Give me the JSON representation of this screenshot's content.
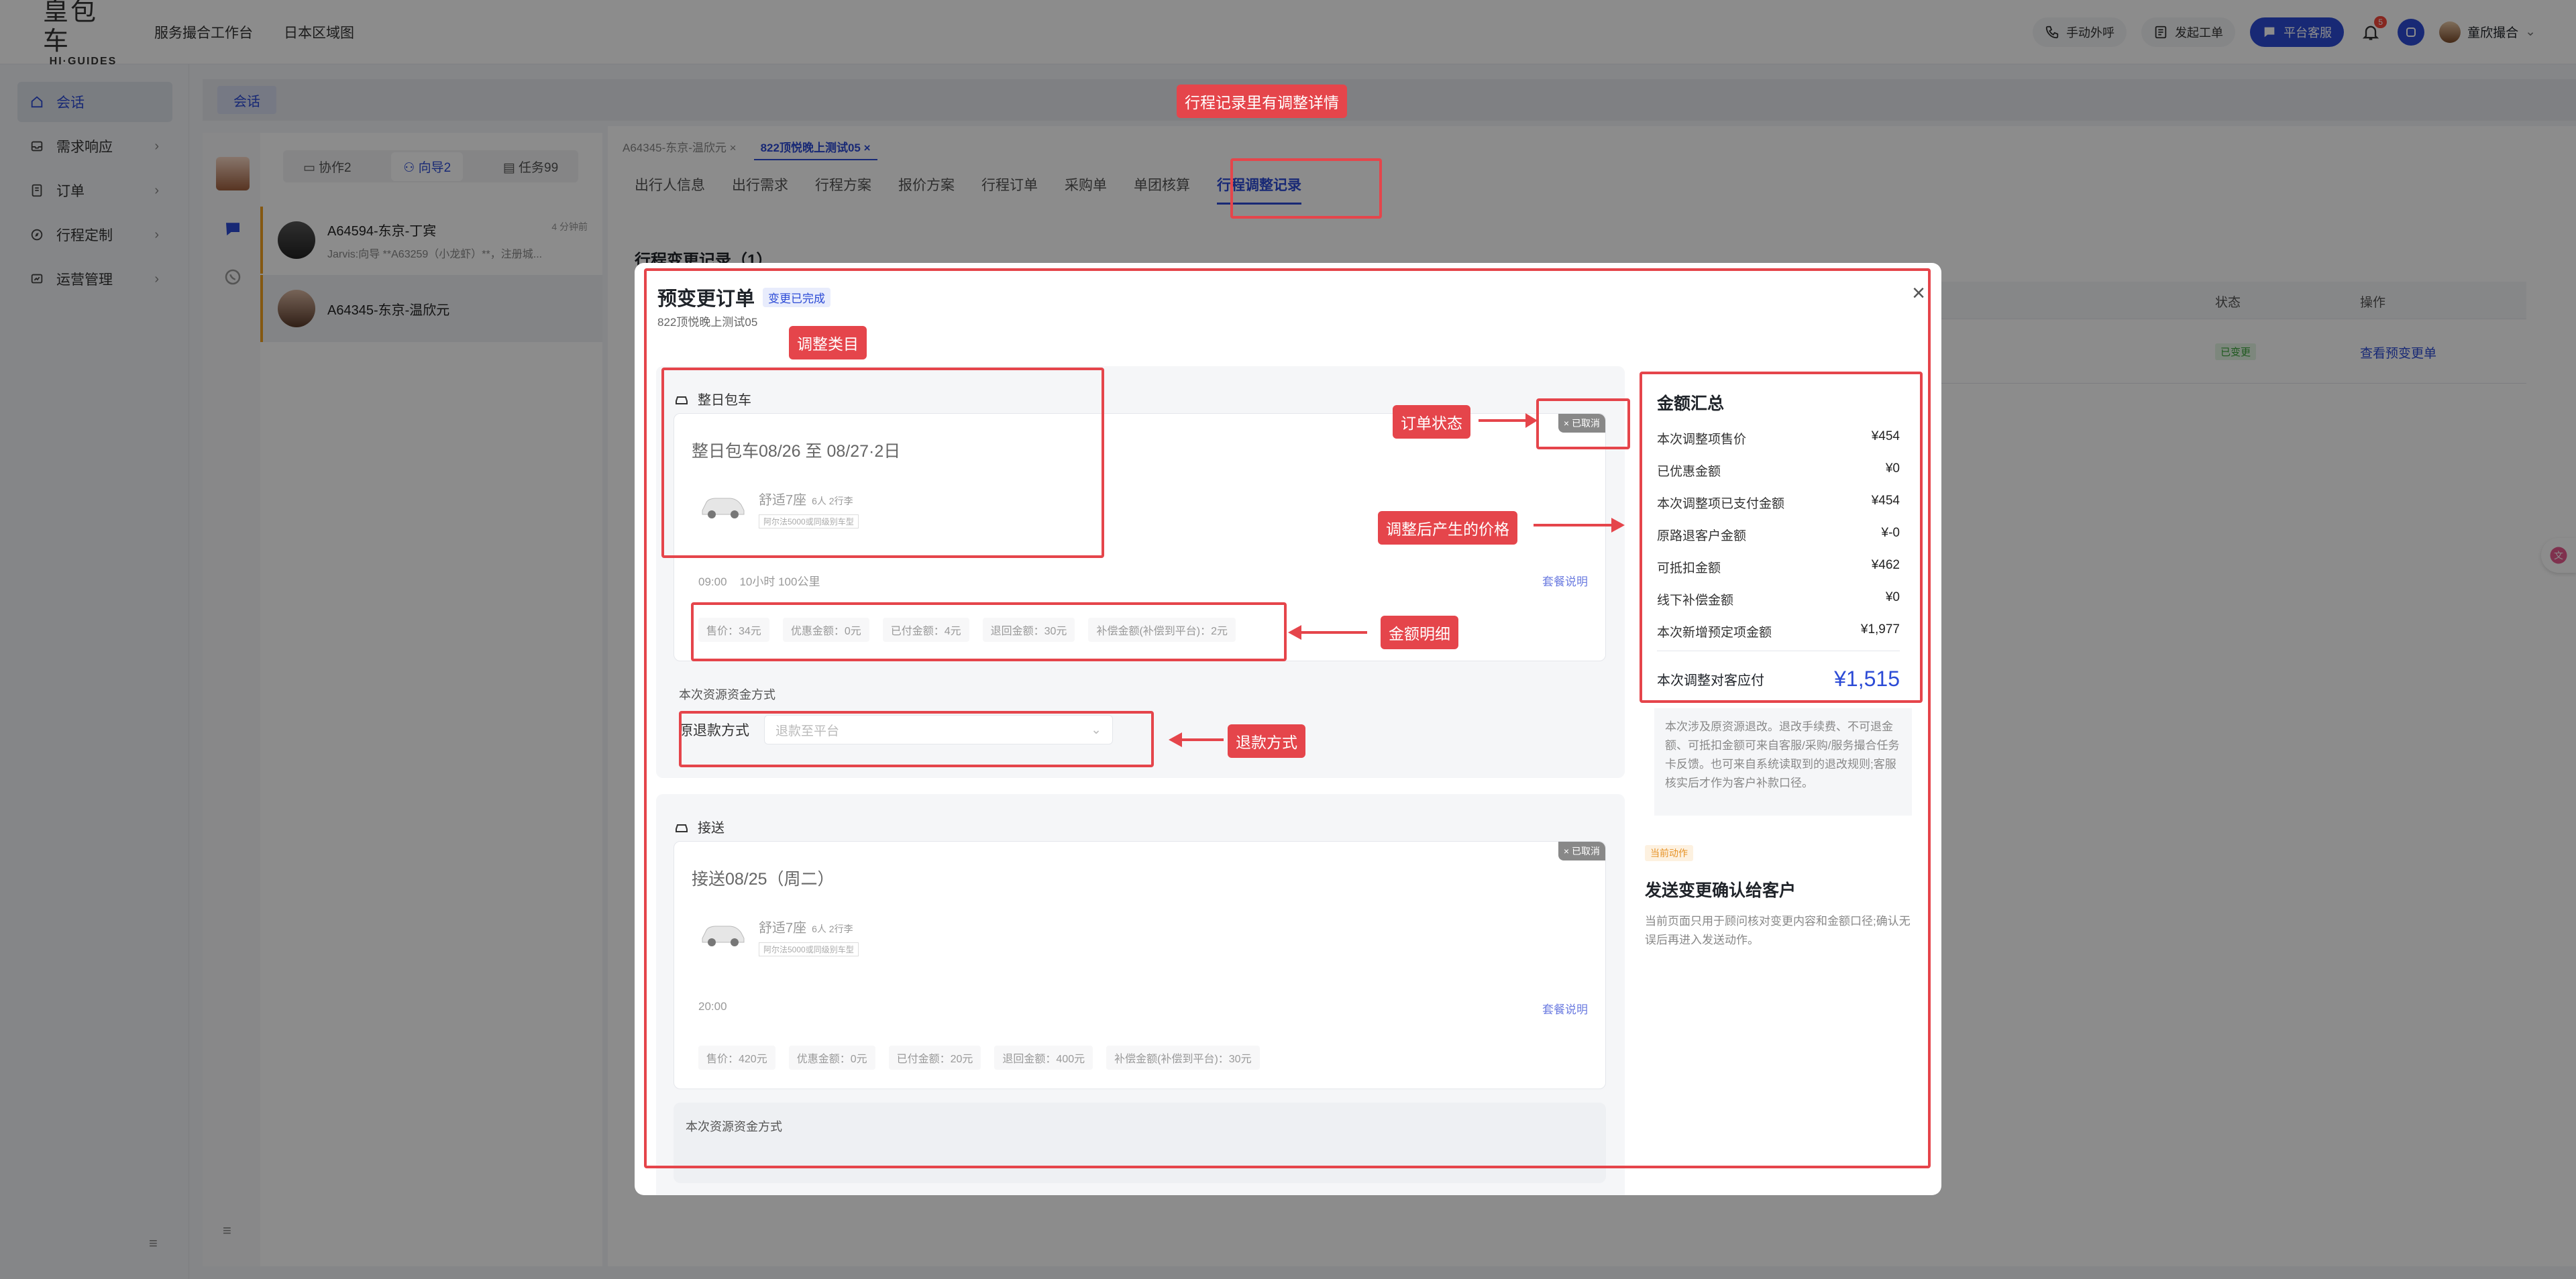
{
  "brand": {
    "cn": "皇包车",
    "en": "HI·GUIDES"
  },
  "topnav": [
    "服务撮合工作台",
    "日本区域图"
  ],
  "topright": {
    "call": "手动外呼",
    "ticket": "发起工单",
    "service": "平台客服",
    "bell_count": "5",
    "user": "童欣撮合"
  },
  "sidebar": {
    "items": [
      {
        "label": "会话"
      },
      {
        "label": "需求响应"
      },
      {
        "label": "订单"
      },
      {
        "label": "行程定制"
      },
      {
        "label": "运营管理"
      }
    ],
    "footer": "≡"
  },
  "session_tab": "会话",
  "chat": {
    "tabs": [
      "协作2",
      "向导2",
      "任务99"
    ],
    "conversations": [
      {
        "name": "A64594-东京-丁宾",
        "message": "Jarvis:向导 **A63259（小龙虾）**，注册城...",
        "time": "4 分钟前"
      },
      {
        "name": "A64345-东京-温欣元",
        "message": "",
        "time": ""
      }
    ],
    "footer": "≡"
  },
  "main": {
    "doc_tabs": [
      "A64345-东京-温欣元 ×",
      "822顶悦晚上测试05 ×"
    ],
    "sub_tabs": [
      "出行人信息",
      "出行需求",
      "行程方案",
      "报价方案",
      "行程订单",
      "采购单",
      "单团核算",
      "行程调整记录"
    ],
    "title": "行程变更记录（1）",
    "table_headers": [
      "状态",
      "操作"
    ],
    "row_status": "已变更",
    "row_action": "查看预变更单"
  },
  "modal": {
    "title": "预变更订单",
    "status": "变更已完成",
    "subtitle": "822顶悦晚上测试05",
    "close": "×",
    "section1": {
      "type": "整日包车",
      "heading": "整日包车08/26 至 08/27·2日",
      "car": "舒适7座",
      "car_meta": "6人 2行李",
      "car_tag": "阿尔法5000或同级别车型",
      "cancel_tag": "× 已取消",
      "time": "09:00",
      "duration": "10小时 100公里",
      "meal_link": "套餐说明",
      "prices": [
        "售价：34元",
        "优惠金额：0元",
        "已付金额：4元",
        "退回金额：30元",
        "补偿金额(补偿到平台)：2元"
      ],
      "fund_label": "本次资源资金方式",
      "refund_method": "原退款方式",
      "refund_placeholder": "退款至平台"
    },
    "section2": {
      "type": "接送",
      "heading": "接送08/25（周二）",
      "car": "舒适7座",
      "car_meta": "6人 2行李",
      "car_tag": "阿尔法5000或同级别车型",
      "cancel_tag": "× 已取消",
      "time": "20:00",
      "meal_link": "套餐说明",
      "prices": [
        "售价：420元",
        "优惠金额：0元",
        "已付金额：20元",
        "退回金额：400元",
        "补偿金额(补偿到平台)：30元"
      ],
      "fund_label": "本次资源资金方式"
    },
    "summary": {
      "title": "金额汇总",
      "rows": [
        {
          "label": "本次调整项售价",
          "value": "¥454"
        },
        {
          "label": "已优惠金额",
          "value": "¥0"
        },
        {
          "label": "本次调整项已支付金额",
          "value": "¥454"
        },
        {
          "label": "原路退客户金额",
          "value": "¥-0"
        },
        {
          "label": "可抵扣金额",
          "value": "¥462"
        },
        {
          "label": "线下补偿金额",
          "value": "¥0"
        },
        {
          "label": "本次新增预定项金额",
          "value": "¥1,977"
        }
      ],
      "total_label": "本次调整对客应付",
      "total_value": "¥1,515"
    },
    "note": "本次涉及原资源退改。退改手续费、不可退金额、可抵扣金额可来自客服/采购/服务撮合任务卡反馈。也可来自系统读取到的退改规则;客服核实后才作为客户补款口径。",
    "action": {
      "tag": "当前动作",
      "title": "发送变更确认给客户",
      "desc": "当前页面只用于顾问核对变更内容和金额口径;确认无误后再进入发送动作。"
    }
  },
  "annotations": {
    "top": "行程记录里有调整详情",
    "category": "调整类目",
    "order_status": "订单状态",
    "price_after": "调整后产生的价格",
    "amount_detail": "金额明细",
    "refund_way": "退款方式"
  },
  "colors": {
    "accent": "#2c4bd6",
    "annotation_red": "#e5454b"
  }
}
